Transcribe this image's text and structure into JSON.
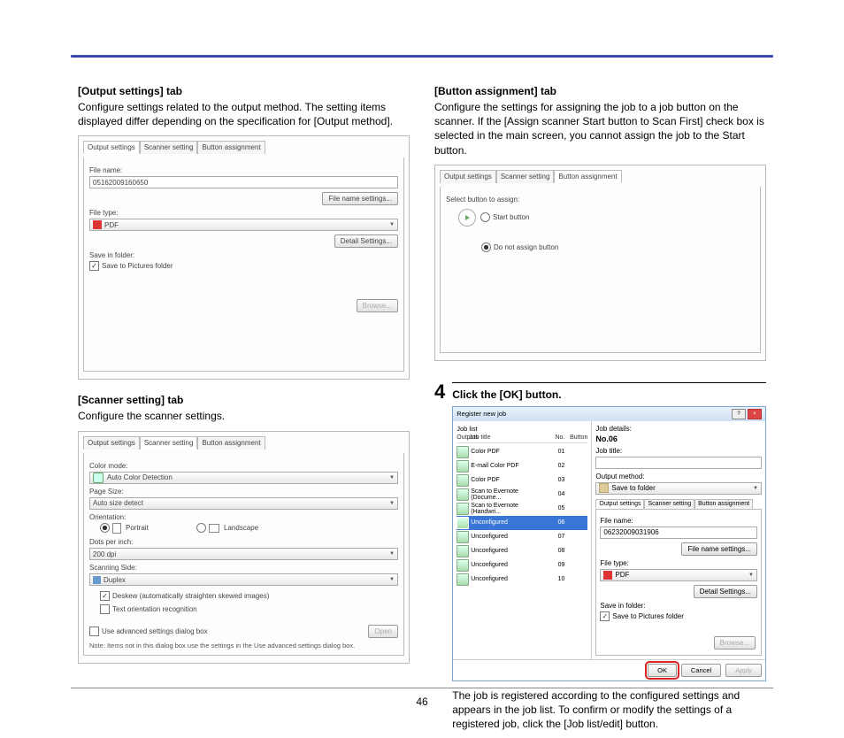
{
  "page_number": "46",
  "left": {
    "s1_title": "[Output settings] tab",
    "s1_body": "Configure settings related to the output method. The setting items displayed differ depending on the specification for [Output method].",
    "s2_title": "[Scanner setting] tab",
    "s2_body": "Configure the scanner settings."
  },
  "right": {
    "s3_title": "[Button assignment] tab",
    "s3_body": "Configure the settings for assigning the job to a job button on the scanner. If the [Assign scanner Start button to Scan First] check box is selected in the main screen, you cannot assign the job to the Start button.",
    "step_num": "4",
    "step_title": "Click the [OK] button.",
    "s4_after": "The job is registered according to the configured settings and appears in the job list. To confirm or modify the settings of a registered job, click the [Job list/edit] button."
  },
  "shot1": {
    "tab1": "Output settings",
    "tab2": "Scanner setting",
    "tab3": "Button assignment",
    "l_filename": "File name:",
    "v_filename": "05162009160650",
    "b_filename": "File name settings...",
    "l_filetype": "File type:",
    "v_filetype": "PDF",
    "b_detail": "Detail Settings...",
    "l_savein": "Save in folder:",
    "cb_save": "Save to Pictures folder",
    "b_browse": "Browse..."
  },
  "shot2": {
    "l_colormode": "Color mode:",
    "v_colormode": "Auto Color Detection",
    "l_pagesize": "Page Size:",
    "v_pagesize": "Auto size detect",
    "l_orient": "Orientation:",
    "rb_portrait": "Portrait",
    "rb_landscape": "Landscape",
    "l_dpi": "Dots per inch:",
    "v_dpi": "200 dpi",
    "l_side": "Scanning Side:",
    "v_side": "Duplex",
    "cb_deskew": "Deskew (automatically straighten skewed images)",
    "cb_textorient": "Text orientation recognition",
    "cb_advanced": "Use advanced settings dialog box",
    "b_open": "Open",
    "note": "Note: Items not in this dialog box use the settings in the Use advanced settings dialog box."
  },
  "shot3": {
    "l_select": "Select button to assign:",
    "rb_start": "Start button",
    "rb_none": "Do not assign button"
  },
  "dlg": {
    "title": "Register new job",
    "h_joblist": "Job list",
    "h_outputs": "Outputs",
    "h_jobtitle": "Job title",
    "h_no": "No.",
    "h_button": "Button",
    "rows": [
      {
        "nm": "Color PDF",
        "no": "01"
      },
      {
        "nm": "E-mail Color PDF",
        "no": "02"
      },
      {
        "nm": "Color PDF",
        "no": "03"
      },
      {
        "nm": "Scan to Evernote (Docume...",
        "no": "04"
      },
      {
        "nm": "Scan to Evernote (Handwri...",
        "no": "05"
      },
      {
        "nm": "Unconfigured",
        "no": "06",
        "sel": true
      },
      {
        "nm": "Unconfigured",
        "no": "07"
      },
      {
        "nm": "Unconfigured",
        "no": "08"
      },
      {
        "nm": "Unconfigured",
        "no": "09"
      },
      {
        "nm": "Unconfigured",
        "no": "10"
      }
    ],
    "det_h": "Job details:",
    "det_no": "No.06",
    "det_jobtitle": "Job title:",
    "det_output": "Output method:",
    "det_output_v": "Save to folder",
    "t1": "Output settings",
    "t2": "Scanner setting",
    "t3": "Button assignment",
    "l_filename": "File name:",
    "v_filename": "06232009031906",
    "b_filename": "File name settings...",
    "l_filetype": "File type:",
    "v_filetype": "PDF",
    "b_detail": "Detail Settings...",
    "l_savein": "Save in folder:",
    "cb_save": "Save to Pictures folder",
    "b_browse": "Browse...",
    "b_ok": "OK",
    "b_cancel": "Cancel",
    "b_apply": "Apply"
  }
}
